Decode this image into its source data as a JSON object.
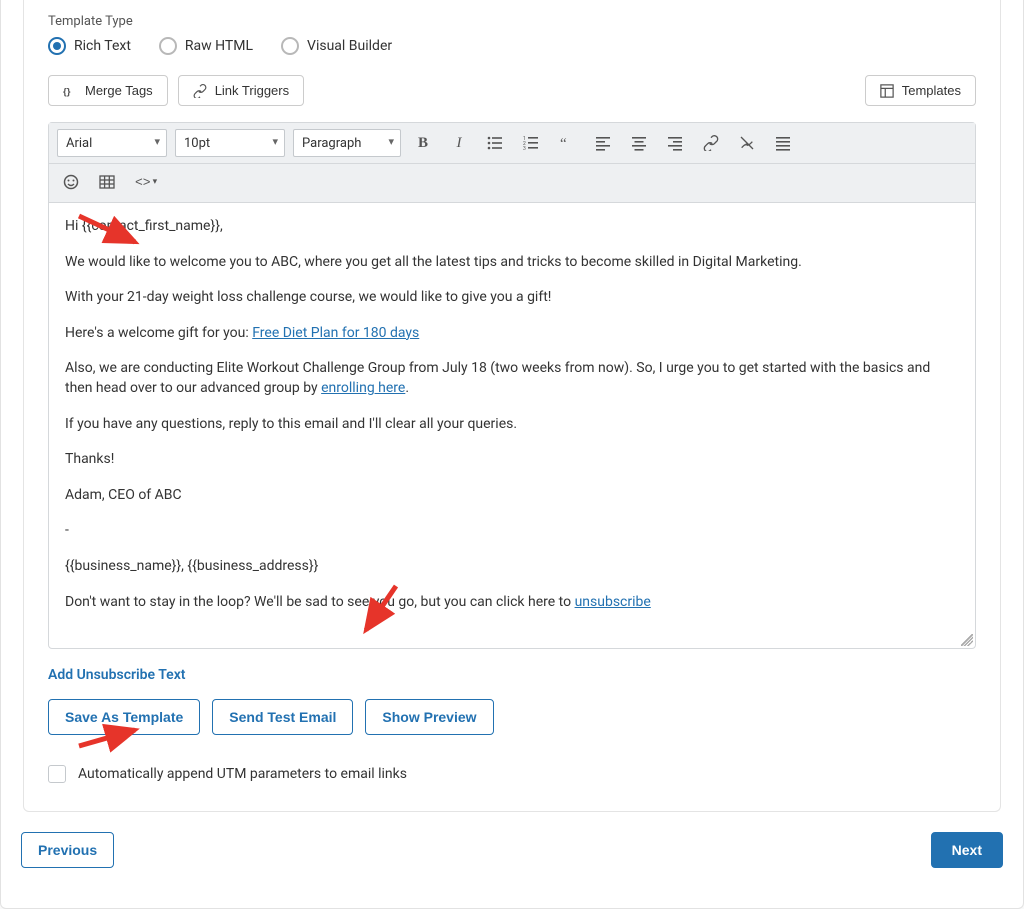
{
  "templateType": {
    "label": "Template Type",
    "options": [
      "Rich Text",
      "Raw HTML",
      "Visual Builder"
    ],
    "selected": "Rich Text"
  },
  "toolbar": {
    "mergeTags": "Merge Tags",
    "linkTriggers": "Link Triggers",
    "templates": "Templates"
  },
  "editor": {
    "fontFamily": "Arial",
    "fontSize": "10pt",
    "blockFormat": "Paragraph"
  },
  "body": {
    "p1": "Hi {{contact_first_name}},",
    "p2": "We would like to welcome you to ABC, where you get all the latest tips and tricks to become skilled in Digital Marketing.",
    "p3": "With your 21-day weight loss challenge course, we would like to give you a gift!",
    "p4a": "Here's a welcome gift for you: ",
    "p4link": "Free Diet Plan for 180 days",
    "p5a": "Also, we are conducting Elite Workout Challenge Group from July 18 (two weeks from now). So, I urge you to get started with the basics and then head over to our advanced group by ",
    "p5link": "enrolling here",
    "p5b": ".",
    "p6": "If you have any questions, reply to this email and I'll clear all your queries.",
    "p7": "Thanks!",
    "p8": "Adam, CEO of ABC",
    "p9": "-",
    "p10": "{{business_name}}, {{business_address}}",
    "p11a": "Don't want to stay in the loop? We'll be sad to see you go, but you can click here to ",
    "p11link": "unsubscribe"
  },
  "actions": {
    "addUnsubscribe": "Add Unsubscribe Text",
    "saveTemplate": "Save As Template",
    "sendTest": "Send Test Email",
    "showPreview": "Show Preview"
  },
  "utm": {
    "label": "Automatically append UTM parameters to email links"
  },
  "nav": {
    "previous": "Previous",
    "next": "Next"
  }
}
